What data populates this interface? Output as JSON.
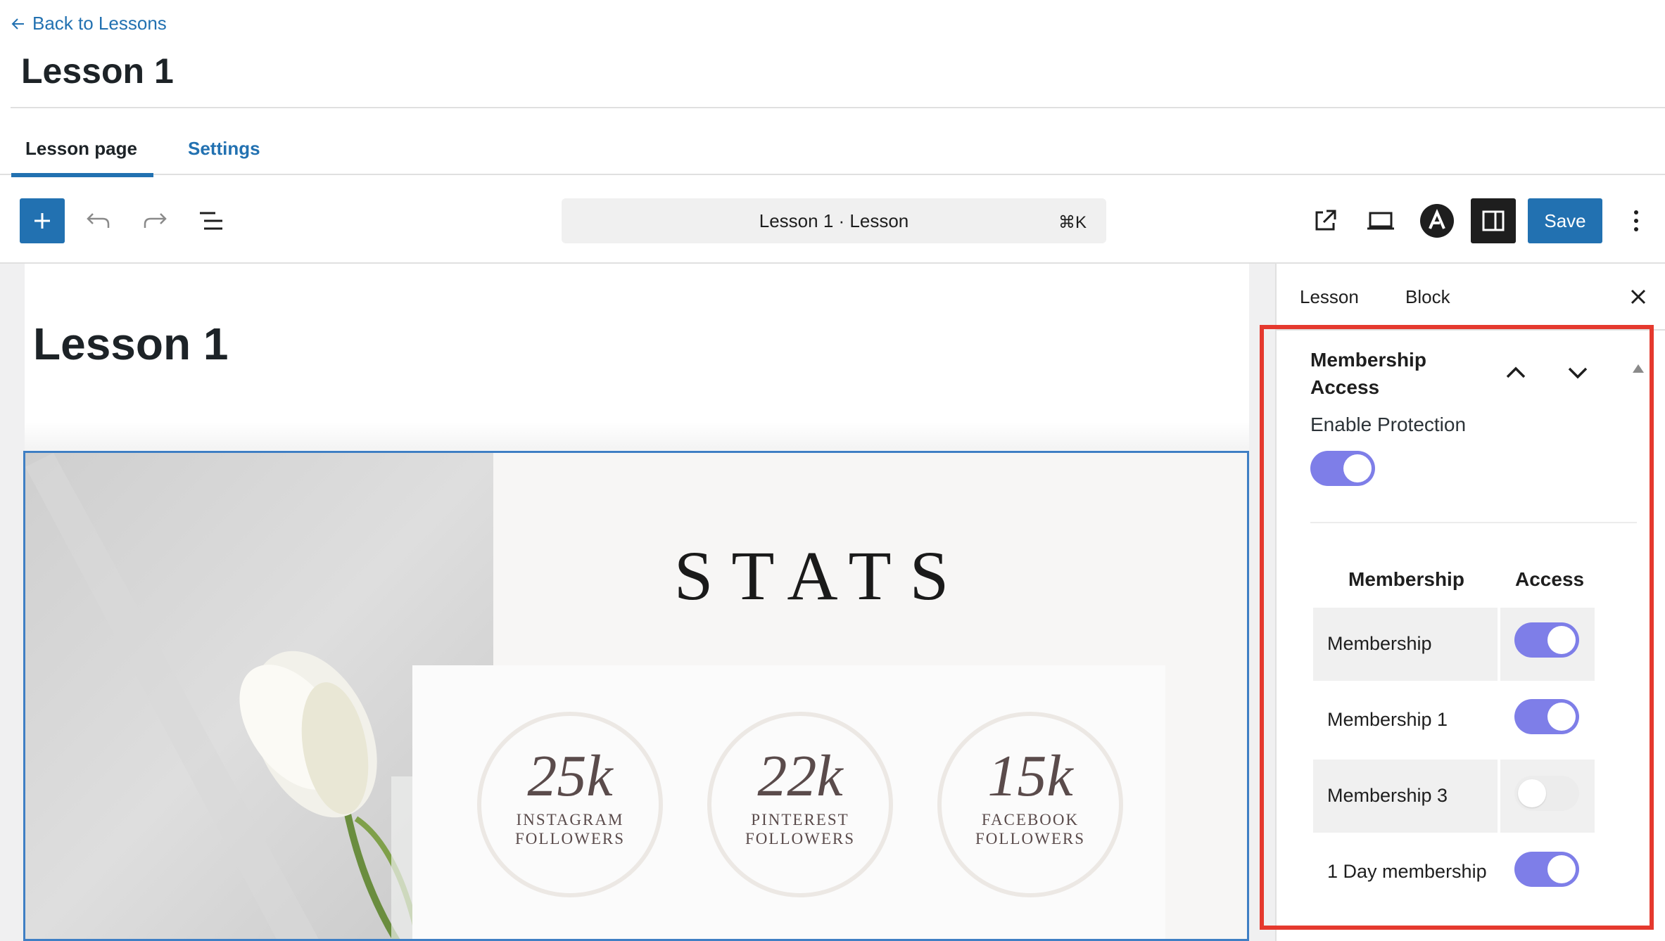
{
  "header": {
    "back_link": "Back to Lessons",
    "title": "Lesson 1",
    "tabs": [
      {
        "label": "Lesson page",
        "active": true
      },
      {
        "label": "Settings",
        "active": false
      }
    ]
  },
  "toolbar": {
    "document_title": "Lesson 1 · Lesson",
    "shortcut": "⌘K",
    "save_label": "Save",
    "icons": [
      "plus-icon",
      "undo-icon",
      "redo-icon",
      "list-view-icon",
      "external-link-icon",
      "laptop-icon",
      "astra-logo-icon",
      "sidebar-toggle-icon",
      "more-vertical-icon"
    ]
  },
  "canvas": {
    "title": "Lesson 1",
    "image": {
      "heading": "STATS",
      "stats": [
        {
          "value": "25k",
          "label_line1": "INSTAGRAM",
          "label_line2": "FOLLOWERS"
        },
        {
          "value": "22k",
          "label_line1": "PINTEREST",
          "label_line2": "FOLLOWERS"
        },
        {
          "value": "15k",
          "label_line1": "FACEBOOK",
          "label_line2": "FOLLOWERS"
        }
      ]
    }
  },
  "sidebar": {
    "tabs": [
      "Lesson",
      "Block"
    ],
    "panel": {
      "title_line1": "Membership",
      "title_line2": "Access",
      "enable_label": "Enable Protection",
      "enable_on": true,
      "table": {
        "headers": [
          "Membership",
          "Access"
        ],
        "rows": [
          {
            "name": "Membership",
            "access": true
          },
          {
            "name": "Membership 1",
            "access": true
          },
          {
            "name": "Membership 3",
            "access": false
          },
          {
            "name": "1 Day membership",
            "access": true
          }
        ]
      }
    }
  },
  "colors": {
    "accent": "#2271b1",
    "toggle_on": "#7e7ee8",
    "toggle_off": "#ececec",
    "highlight_box": "#e5392e"
  }
}
